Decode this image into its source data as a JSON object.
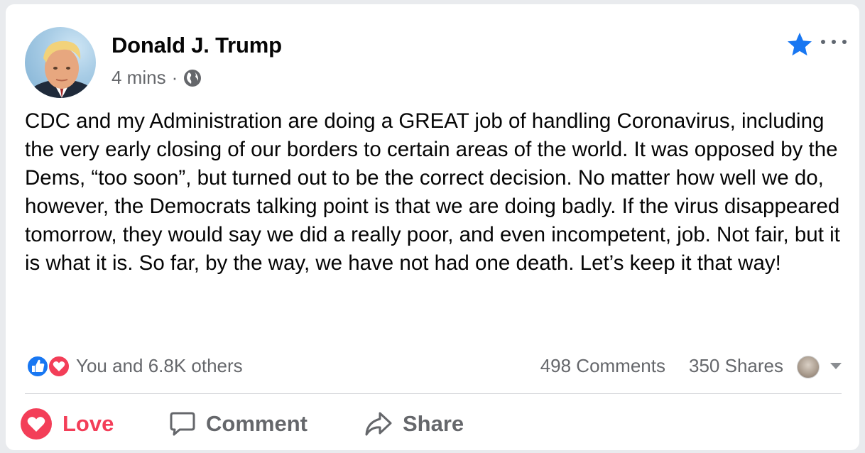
{
  "post": {
    "author": "Donald J. Trump",
    "time": "4 mins",
    "separator": "·",
    "privacy_icon": "globe-icon",
    "text": "CDC and my Administration are doing a GREAT job of handling Coronavirus, including the very early closing of our borders to certain areas of the world. It was opposed by the Dems, “too soon”, but turned out to be the correct decision. No matter how well we do, however, the Democrats talking point is that we are doing badly. If the virus disappeared tomorrow, they would say we did a really poor, and even incompetent, job. Not fair, but it is what it is. So far, by the way, we have not had one death. Let’s keep it that way!"
  },
  "header_actions": {
    "favorite_icon": "star-icon",
    "more_icon": "more-horizontal-icon"
  },
  "reactions": {
    "icons": [
      "like-icon",
      "love-icon"
    ],
    "summary": "You and 6.8K others",
    "comments": "498 Comments",
    "shares": "350 Shares"
  },
  "actions": {
    "love_label": "Love",
    "comment_label": "Comment",
    "share_label": "Share"
  },
  "colors": {
    "accent_blue": "#1877f2",
    "love_red": "#f33e58",
    "secondary_text": "#65676b",
    "primary_text": "#050505",
    "page_background": "#e9ebee",
    "card_background": "#ffffff"
  }
}
